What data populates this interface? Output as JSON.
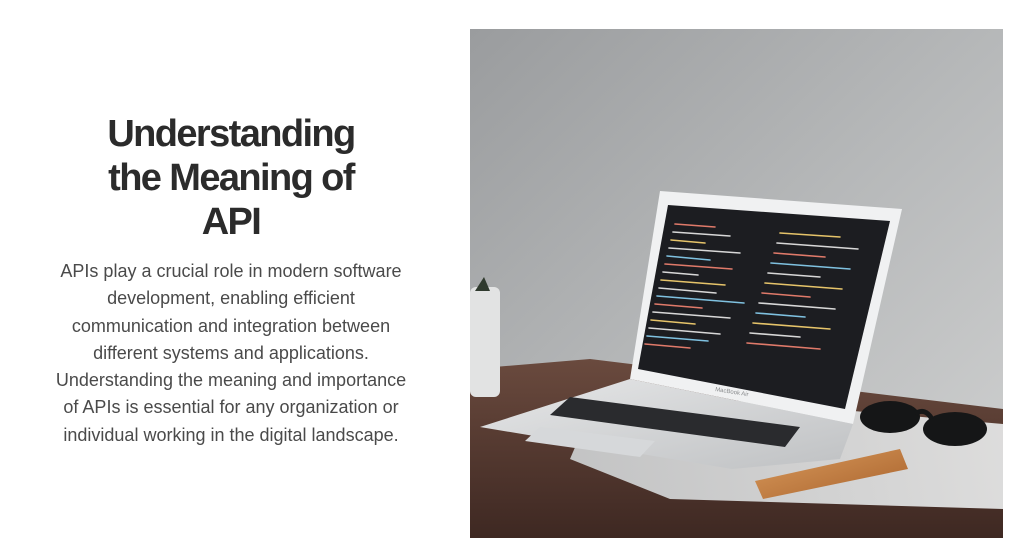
{
  "hero": {
    "title_lines": [
      "Understanding",
      "the Meaning of",
      "API"
    ],
    "description_lines": [
      "APIs play a crucial role in modern software",
      "development, enabling efficient",
      "communication and integration between",
      "different systems and applications.",
      "Understanding the meaning and importance",
      "of APIs is essential for any organization or",
      "individual working in the digital landscape."
    ],
    "image": {
      "subject": "laptop-with-code-on-desk",
      "laptop_brand_text": "MacBook Air"
    }
  }
}
